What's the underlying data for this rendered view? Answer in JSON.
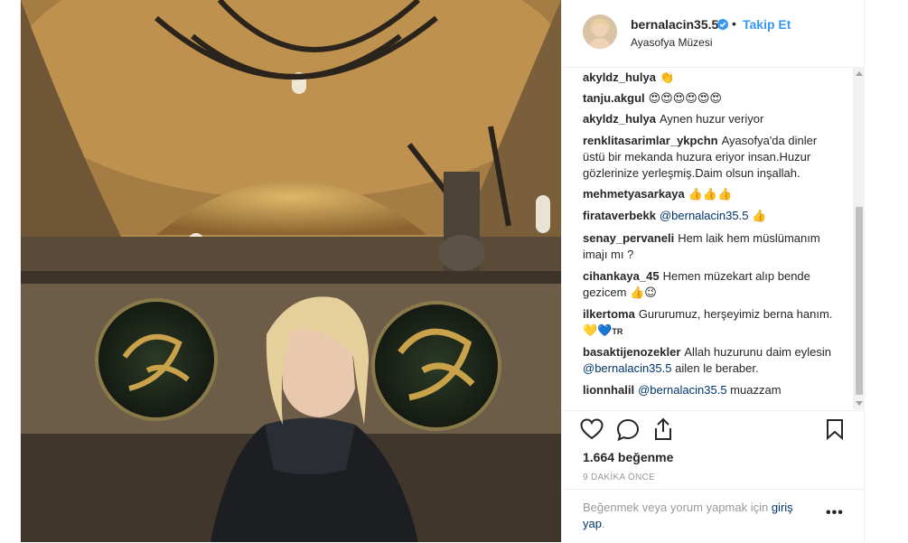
{
  "post": {
    "username": "bernalacin35.5",
    "follow_label": "Takip Et",
    "separator": "•",
    "location": "Ayasofya Müzesi",
    "likes": "1.664 beğenme",
    "time": "9 DAKİKA ÖNCE"
  },
  "comments": [
    {
      "user": "akyldz_hulya",
      "text": "",
      "emoji": "👏"
    },
    {
      "user": "tanju.akgul",
      "text": "",
      "emoji": "😍😍😍😍😍😍"
    },
    {
      "user": "akyldz_hulya",
      "text": "Aynen huzur veriyor",
      "emoji": ""
    },
    {
      "user": "renklitasarimlar_ykpchn",
      "text": "Ayasofya'da dinler üstü bir mekanda huzura eriyor insan.Huzur gözlerinize yerleşmiş.Daim olsun inşallah.",
      "emoji": ""
    },
    {
      "user": "mehmetyasarkaya",
      "text": "",
      "emoji": "👍👍👍"
    },
    {
      "user": "firataverbekk",
      "mention": "@bernalacin35.5",
      "emoji": "👍"
    },
    {
      "user": "senay_pervaneli",
      "text": "Hem laik hem müslümanım imajı mı ?",
      "emoji": ""
    },
    {
      "user": "cihankaya_45",
      "text": "Hemen müzekart alıp bende gezicem",
      "emoji": "👍😉"
    },
    {
      "user": "ilkertoma",
      "text": "Gururumuz, herşeyimiz berna hanım.",
      "emoji": "💛💙",
      "suffix": "TR"
    },
    {
      "user": "basaktijenozekler",
      "text": "Allah huzurunu daim eylesin",
      "mention": "@bernalacin35.5",
      "text2": "ailen le beraber.",
      "emoji": ""
    },
    {
      "user": "lionnhalil",
      "mention": "@bernalacin35.5",
      "text2": "muazzam",
      "emoji": ""
    }
  ],
  "login": {
    "prefix": "Beğenmek veya yorum yapmak için",
    "link": "giriş yap",
    "suffix": "."
  },
  "more_label": "•••",
  "icons": {
    "like": "heart-icon",
    "comment": "comment-icon",
    "share": "share-icon",
    "save": "bookmark-icon",
    "verified": "verified-badge-icon"
  },
  "colors": {
    "accent": "#3897f0",
    "link": "#003569",
    "text": "#262626",
    "muted": "#999999",
    "verified": "#3897f0"
  }
}
